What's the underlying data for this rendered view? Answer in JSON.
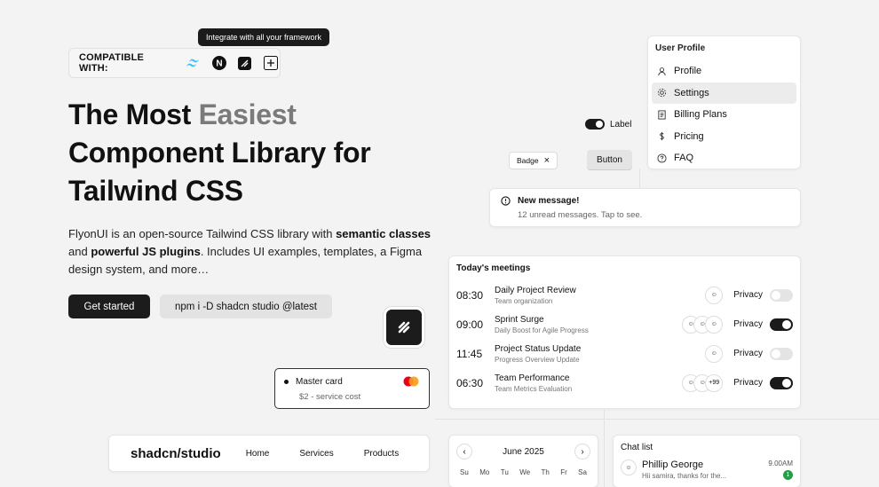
{
  "tooltip": "Integrate with all your framework",
  "compat": {
    "label": "COMPATIBLE WITH:",
    "icons": [
      "tailwind-icon",
      "nextjs-icon",
      "shadcn-icon",
      "plus-icon"
    ]
  },
  "hero": {
    "line1_a": "The Most ",
    "line1_b": "Easiest",
    "line2": "Component Library for",
    "line3": "Tailwind CSS",
    "desc_1": "FlyonUI is an open-source Tailwind CSS library with ",
    "desc_b1": "semantic classes",
    "desc_2": " and ",
    "desc_b2": "powerful JS plugins",
    "desc_3": ". Includes UI examples, templates, a Figma design system, and more…",
    "cta_primary": "Get started",
    "cta_secondary": "npm i -D shadcn studio @latest"
  },
  "menu": {
    "title": "User Profile",
    "items": [
      {
        "label": "Profile",
        "icon": "user-icon"
      },
      {
        "label": "Settings",
        "icon": "gear-icon",
        "active": true
      },
      {
        "label": "Billing Plans",
        "icon": "receipt-icon"
      },
      {
        "label": "Pricing",
        "icon": "dollar-icon"
      },
      {
        "label": "FAQ",
        "icon": "help-icon"
      }
    ]
  },
  "switch": {
    "label": "Label",
    "on": true
  },
  "badge": {
    "label": "Badge",
    "close": "×"
  },
  "button": {
    "label": "Button"
  },
  "toast": {
    "title": "New message!",
    "subtitle": "12 unread messages. Tap to see."
  },
  "meetings": {
    "title": "Today's meetings",
    "rows": [
      {
        "time": "08:30",
        "name": "Daily Project Review",
        "sub": "Team organization",
        "privacy": "Privacy",
        "on": false
      },
      {
        "time": "09:00",
        "name": "Sprint Surge",
        "sub": "Daily Boost for Agile Progress",
        "privacy": "Privacy",
        "on": true
      },
      {
        "time": "11:45",
        "name": "Project Status Update",
        "sub": "Progress Overview Update",
        "privacy": "Privacy",
        "on": false
      },
      {
        "time": "06:30",
        "name": "Team Performance",
        "sub": "Team Metrics Evaluation",
        "privacy": "Privacy",
        "on": true,
        "extra": "+99"
      }
    ]
  },
  "mastercard": {
    "name": "Master card",
    "sub": "$2 - service cost"
  },
  "navbar": {
    "brand": "shadcn/studio",
    "links": [
      "Home",
      "Services",
      "Products"
    ]
  },
  "calendar": {
    "month": "June 2025",
    "prev": "‹",
    "next": "›",
    "days": [
      "Su",
      "Mo",
      "Tu",
      "We",
      "Th",
      "Fr",
      "Sa"
    ]
  },
  "chat": {
    "title": "Chat list",
    "name": "Phillip George",
    "msg": "Hii samira, thanks for the...",
    "time": "9.00AM",
    "unread": "1"
  },
  "colors": {
    "accent": "#1c1c1c",
    "muted": "#7a7a7a",
    "success": "#22a045"
  }
}
